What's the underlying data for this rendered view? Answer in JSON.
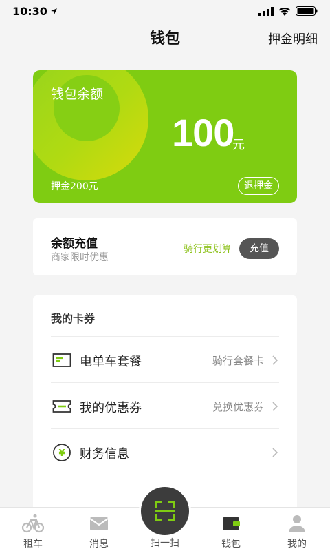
{
  "status_bar": {
    "time": "10:30"
  },
  "nav": {
    "title": "钱包",
    "right_link": "押金明细"
  },
  "wallet_card": {
    "label": "钱包余额",
    "amount": "100",
    "unit": "元",
    "deposit": "押金200元",
    "refund_button": "退押金"
  },
  "topup": {
    "title": "余额充值",
    "subtitle": "商家限时优惠",
    "hint": "骑行更划算",
    "button": "充值"
  },
  "coupons": {
    "title": "我的卡券",
    "rows": [
      {
        "label": "电单车套餐",
        "right": "骑行套餐卡",
        "icon": "package-card-icon"
      },
      {
        "label": "我的优惠券",
        "right": "兑换优惠券",
        "icon": "coupon-ticket-icon"
      },
      {
        "label": "财务信息",
        "right": "",
        "icon": "yuan-circle-icon"
      }
    ]
  },
  "tabbar": {
    "tabs": [
      {
        "label": "租车",
        "icon": "bicycle-icon"
      },
      {
        "label": "消息",
        "icon": "mail-icon"
      },
      {
        "label": "扫一扫",
        "icon": "scan-icon"
      },
      {
        "label": "钱包",
        "icon": "wallet-icon",
        "active": true
      },
      {
        "label": "我的",
        "icon": "person-icon"
      }
    ]
  },
  "colors": {
    "accent": "#7fcc12",
    "hint_green": "#8ec21d",
    "dark_button": "#555555"
  }
}
